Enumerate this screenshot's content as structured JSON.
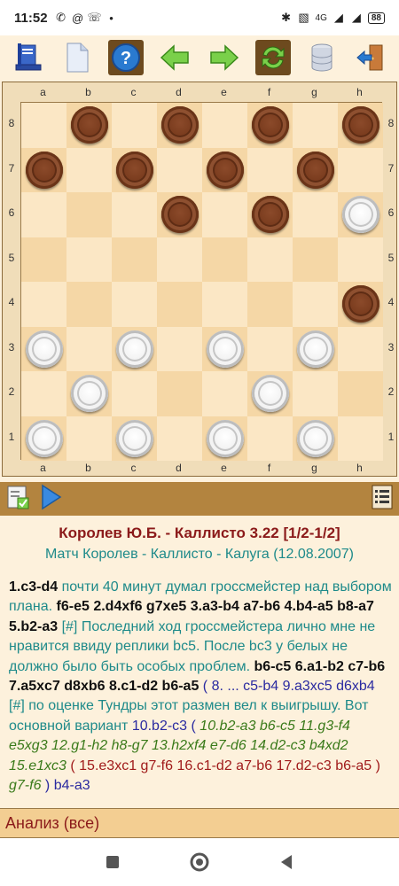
{
  "status_bar": {
    "time": "11:52",
    "network": "4G",
    "battery": "88"
  },
  "board": {
    "files": [
      "a",
      "b",
      "c",
      "d",
      "e",
      "f",
      "g",
      "h"
    ],
    "ranks": [
      "8",
      "7",
      "6",
      "5",
      "4",
      "3",
      "2",
      "1"
    ],
    "pieces": [
      {
        "square": "b8",
        "color": "black"
      },
      {
        "square": "d8",
        "color": "black"
      },
      {
        "square": "f8",
        "color": "black"
      },
      {
        "square": "h8",
        "color": "black"
      },
      {
        "square": "a7",
        "color": "black"
      },
      {
        "square": "c7",
        "color": "black"
      },
      {
        "square": "e7",
        "color": "black"
      },
      {
        "square": "g7",
        "color": "black"
      },
      {
        "square": "d6",
        "color": "black"
      },
      {
        "square": "f6",
        "color": "black"
      },
      {
        "square": "h6",
        "color": "white"
      },
      {
        "square": "h4",
        "color": "black"
      },
      {
        "square": "a3",
        "color": "white"
      },
      {
        "square": "c3",
        "color": "white"
      },
      {
        "square": "e3",
        "color": "white"
      },
      {
        "square": "g3",
        "color": "white"
      },
      {
        "square": "b2",
        "color": "white"
      },
      {
        "square": "f2",
        "color": "white"
      },
      {
        "square": "a1",
        "color": "white"
      },
      {
        "square": "c1",
        "color": "white"
      },
      {
        "square": "e1",
        "color": "white"
      },
      {
        "square": "g1",
        "color": "white"
      }
    ]
  },
  "game": {
    "title": "Королев Ю.Б. - Каллисто 3.22 [1/2-1/2]",
    "subtitle": "Матч Королев - Каллисто - Калуга (12.08.2007)"
  },
  "moves": [
    {
      "t": "mv",
      "s": "1.c3-d4"
    },
    {
      "t": "cm",
      "s": " почти 40 минут думал гроссмейстер над выбором плана. "
    },
    {
      "t": "mv",
      "s": "f6-e5 2.d4xf6 g7xe5 3.a3-b4 a7-b6 4.b4-a5 b8-a7 5.b2-a3"
    },
    {
      "t": "cm",
      "s": " [#] Последний ход гроссмейстера лично мне не нравится ввиду реплики bc5. После bc3 у белых не должно было быть особых проблем. "
    },
    {
      "t": "mv",
      "s": "b6-c5 6.a1-b2 c7-b6 7.a5xc7 d8xb6 8.c1-d2 b6-a5"
    },
    {
      "t": "vr",
      "s": " ( 8. ... c5-b4 9.a3xc5 d6xb4"
    },
    {
      "t": "cm",
      "s": " [#] по оценке Тундры этот размен вел к выигрышу. Вот основной вариант "
    },
    {
      "t": "vr",
      "s": "10.b2-c3 ( "
    },
    {
      "t": "vr2",
      "s": "10.b2-a3 b6-c5 11.g3-f4 e5xg3 12.g1-h2 h8-g7 13.h2xf4 e7-d6 14.d2-c3 b4xd2 15.e1xc3"
    },
    {
      "t": "vr3",
      "s": " ( 15.e3xc1 g7-f6 16.c1-d2 a7-b6 17.d2-c3 b6-a5 ) "
    },
    {
      "t": "vr2",
      "s": "g7-f6"
    },
    {
      "t": "vr",
      "s": " ) b4-a3"
    }
  ],
  "analysis": {
    "label": "Анализ (все)"
  },
  "colors": {
    "background": "#fdf1dc",
    "light_square": "#fbe7c5",
    "dark_square": "#f5d7a6",
    "title": "#8b1a1a",
    "subtitle": "#1e8a8a",
    "notation_bar": "#b3843f",
    "analysis_bar": "#f3ce92"
  },
  "icons": {
    "toolbar": [
      "book-icon",
      "new-document-icon",
      "help-icon",
      "back-arrow-icon",
      "forward-arrow-icon",
      "flip-board-icon",
      "database-icon",
      "exit-door-icon"
    ],
    "notation_bar": [
      "notation-edit-icon",
      "play-icon",
      "list-menu-icon"
    ],
    "navbar": [
      "recent-apps-icon",
      "home-icon",
      "back-icon"
    ]
  }
}
